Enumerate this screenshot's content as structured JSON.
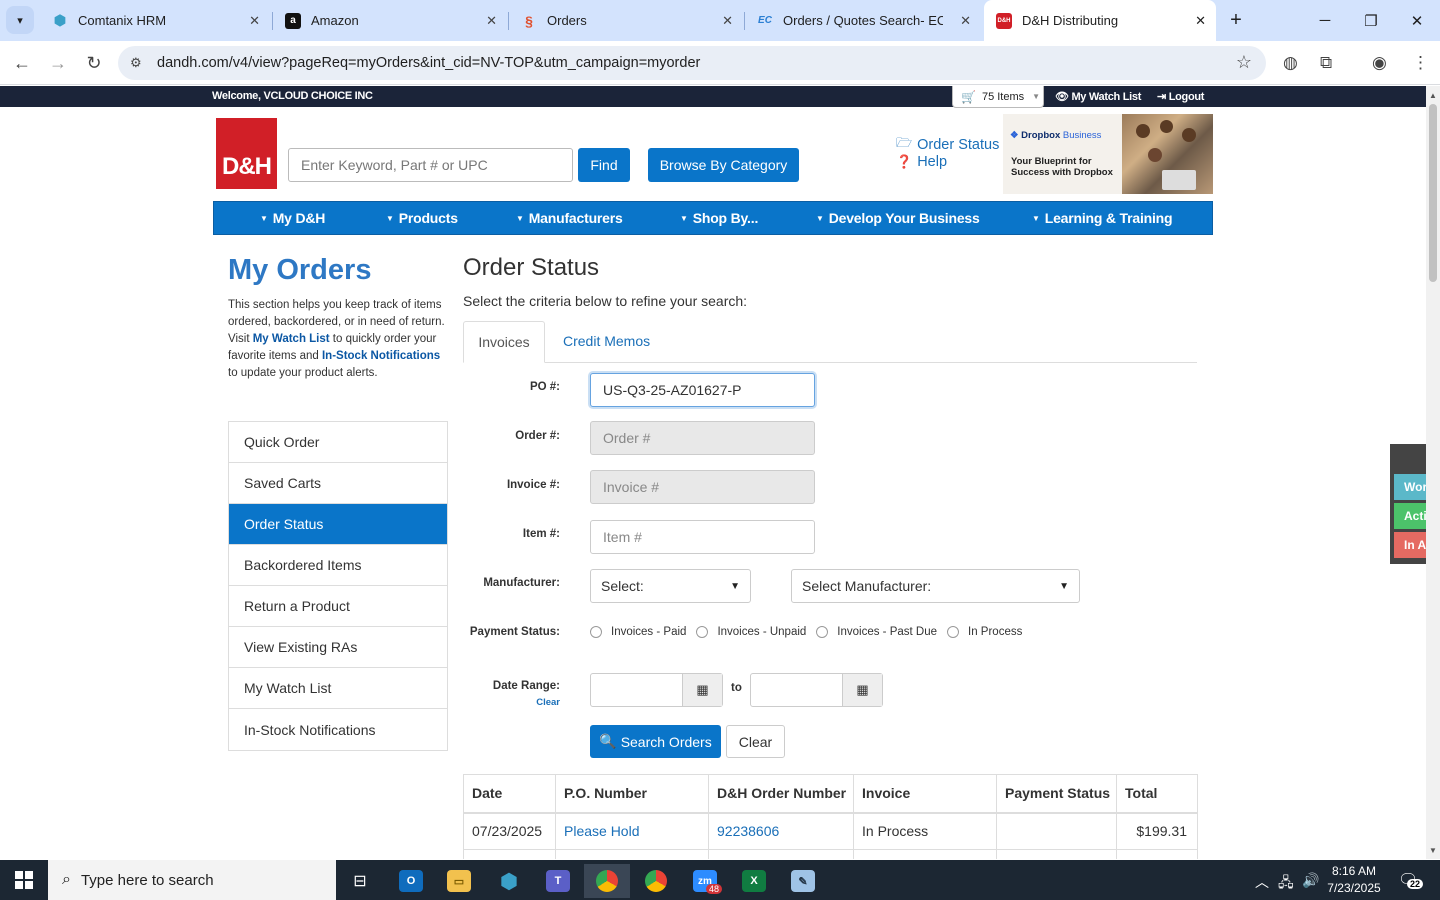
{
  "browser": {
    "tabs": [
      {
        "title": "Comtanix HRM",
        "icon": "hexagon-icon"
      },
      {
        "title": "Amazon",
        "icon": "amazon-icon"
      },
      {
        "title": "Orders",
        "icon": "shopify-swirl-icon"
      },
      {
        "title": "Orders / Quotes Search- ECExp",
        "icon": "ec-icon"
      },
      {
        "title": "D&H Distributing",
        "icon": "dh-icon",
        "active": true
      }
    ],
    "url": "dandh.com/v4/view?pageReq=myOrders&int_cid=NV-TOP&utm_campaign=myorder"
  },
  "topbar": {
    "welcome": "Welcome, VCLOUD CHOICE INC",
    "cart_count": "75 Items",
    "watch_list": "My Watch List",
    "logout": "Logout"
  },
  "header": {
    "logo_text": "D&H",
    "search_placeholder": "Enter Keyword, Part # or UPC",
    "find_label": "Find",
    "browse_label": "Browse By Category",
    "order_status_link": "Order Status",
    "help_link": "Help",
    "ad": {
      "brand": "Dropbox",
      "brand_sub": "Business",
      "tagline": "Your Blueprint for Success with Dropbox"
    }
  },
  "nav": {
    "items": [
      "My D&H",
      "Products",
      "Manufacturers",
      "Shop By...",
      "Develop Your Business",
      "Learning & Training"
    ]
  },
  "sidebar": {
    "heading": "My Orders",
    "intro_1": "This section helps you keep track of items ordered, backordered, or in need of return. Visit ",
    "intro_link1": "My Watch List",
    "intro_2": " to quickly order your favorite items and ",
    "intro_link2": "In-Stock Notifications",
    "intro_3": " to update your product alerts.",
    "menu": [
      {
        "label": "Quick Order"
      },
      {
        "label": "Saved Carts"
      },
      {
        "label": "Order Status",
        "active": true
      },
      {
        "label": "Backordered Items"
      },
      {
        "label": "Return a Product"
      },
      {
        "label": "View Existing RAs"
      },
      {
        "label": "My Watch List"
      },
      {
        "label": "In-Stock Notifications"
      }
    ]
  },
  "main": {
    "title": "Order Status",
    "subtitle": "Select the criteria below to refine your search:",
    "tabs": [
      "Invoices",
      "Credit Memos"
    ],
    "form": {
      "po_label": "PO #:",
      "po_value": "US-Q3-25-AZ01627-P",
      "order_label": "Order #:",
      "order_placeholder": "Order #",
      "invoice_label": "Invoice #:",
      "invoice_placeholder": "Invoice #",
      "item_label": "Item #:",
      "item_placeholder": "Item #",
      "manufacturer_label": "Manufacturer:",
      "manufacturer_select1": "Select:",
      "manufacturer_select2": "Select Manufacturer:",
      "payment_label": "Payment Status:",
      "payment_options": [
        "Invoices - Paid",
        "Invoices - Unpaid",
        "Invoices - Past Due",
        "In Process"
      ],
      "date_label": "Date Range:",
      "date_clear": "Clear",
      "date_to": "to",
      "search_btn": "Search Orders",
      "clear_btn": "Clear"
    },
    "table": {
      "headers": [
        "Date",
        "P.O. Number",
        "D&H Order Number",
        "Invoice",
        "Payment Status",
        "Total"
      ],
      "rows": [
        [
          "07/23/2025",
          "Please Hold",
          "92238606",
          "In Process",
          "",
          "$199.31"
        ]
      ]
    }
  },
  "side_widget": {
    "items": [
      {
        "label": "Working",
        "color": "#5bb8c9"
      },
      {
        "label": "Active",
        "color": "#4cc36a"
      },
      {
        "label": "In Active",
        "color": "#e56a62"
      }
    ]
  },
  "taskbar": {
    "search_placeholder": "Type here to search",
    "time": "8:16 AM",
    "date": "7/23/2025",
    "notification_count": "22",
    "zoom_badge": "48"
  }
}
